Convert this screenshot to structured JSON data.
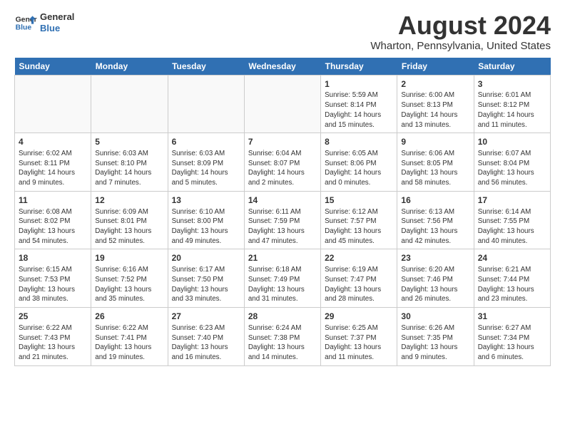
{
  "header": {
    "logo_line1": "General",
    "logo_line2": "Blue",
    "month_year": "August 2024",
    "location": "Wharton, Pennsylvania, United States"
  },
  "weekdays": [
    "Sunday",
    "Monday",
    "Tuesday",
    "Wednesday",
    "Thursday",
    "Friday",
    "Saturday"
  ],
  "weeks": [
    [
      {
        "day": "",
        "empty": true
      },
      {
        "day": "",
        "empty": true
      },
      {
        "day": "",
        "empty": true
      },
      {
        "day": "",
        "empty": true
      },
      {
        "day": "1",
        "sunrise": "5:59 AM",
        "sunset": "8:14 PM",
        "daylight": "14 hours and 15 minutes."
      },
      {
        "day": "2",
        "sunrise": "6:00 AM",
        "sunset": "8:13 PM",
        "daylight": "14 hours and 13 minutes."
      },
      {
        "day": "3",
        "sunrise": "6:01 AM",
        "sunset": "8:12 PM",
        "daylight": "14 hours and 11 minutes."
      }
    ],
    [
      {
        "day": "4",
        "sunrise": "6:02 AM",
        "sunset": "8:11 PM",
        "daylight": "14 hours and 9 minutes."
      },
      {
        "day": "5",
        "sunrise": "6:03 AM",
        "sunset": "8:10 PM",
        "daylight": "14 hours and 7 minutes."
      },
      {
        "day": "6",
        "sunrise": "6:03 AM",
        "sunset": "8:09 PM",
        "daylight": "14 hours and 5 minutes."
      },
      {
        "day": "7",
        "sunrise": "6:04 AM",
        "sunset": "8:07 PM",
        "daylight": "14 hours and 2 minutes."
      },
      {
        "day": "8",
        "sunrise": "6:05 AM",
        "sunset": "8:06 PM",
        "daylight": "14 hours and 0 minutes."
      },
      {
        "day": "9",
        "sunrise": "6:06 AM",
        "sunset": "8:05 PM",
        "daylight": "13 hours and 58 minutes."
      },
      {
        "day": "10",
        "sunrise": "6:07 AM",
        "sunset": "8:04 PM",
        "daylight": "13 hours and 56 minutes."
      }
    ],
    [
      {
        "day": "11",
        "sunrise": "6:08 AM",
        "sunset": "8:02 PM",
        "daylight": "13 hours and 54 minutes."
      },
      {
        "day": "12",
        "sunrise": "6:09 AM",
        "sunset": "8:01 PM",
        "daylight": "13 hours and 52 minutes."
      },
      {
        "day": "13",
        "sunrise": "6:10 AM",
        "sunset": "8:00 PM",
        "daylight": "13 hours and 49 minutes."
      },
      {
        "day": "14",
        "sunrise": "6:11 AM",
        "sunset": "7:59 PM",
        "daylight": "13 hours and 47 minutes."
      },
      {
        "day": "15",
        "sunrise": "6:12 AM",
        "sunset": "7:57 PM",
        "daylight": "13 hours and 45 minutes."
      },
      {
        "day": "16",
        "sunrise": "6:13 AM",
        "sunset": "7:56 PM",
        "daylight": "13 hours and 42 minutes."
      },
      {
        "day": "17",
        "sunrise": "6:14 AM",
        "sunset": "7:55 PM",
        "daylight": "13 hours and 40 minutes."
      }
    ],
    [
      {
        "day": "18",
        "sunrise": "6:15 AM",
        "sunset": "7:53 PM",
        "daylight": "13 hours and 38 minutes."
      },
      {
        "day": "19",
        "sunrise": "6:16 AM",
        "sunset": "7:52 PM",
        "daylight": "13 hours and 35 minutes."
      },
      {
        "day": "20",
        "sunrise": "6:17 AM",
        "sunset": "7:50 PM",
        "daylight": "13 hours and 33 minutes."
      },
      {
        "day": "21",
        "sunrise": "6:18 AM",
        "sunset": "7:49 PM",
        "daylight": "13 hours and 31 minutes."
      },
      {
        "day": "22",
        "sunrise": "6:19 AM",
        "sunset": "7:47 PM",
        "daylight": "13 hours and 28 minutes."
      },
      {
        "day": "23",
        "sunrise": "6:20 AM",
        "sunset": "7:46 PM",
        "daylight": "13 hours and 26 minutes."
      },
      {
        "day": "24",
        "sunrise": "6:21 AM",
        "sunset": "7:44 PM",
        "daylight": "13 hours and 23 minutes."
      }
    ],
    [
      {
        "day": "25",
        "sunrise": "6:22 AM",
        "sunset": "7:43 PM",
        "daylight": "13 hours and 21 minutes."
      },
      {
        "day": "26",
        "sunrise": "6:22 AM",
        "sunset": "7:41 PM",
        "daylight": "13 hours and 19 minutes."
      },
      {
        "day": "27",
        "sunrise": "6:23 AM",
        "sunset": "7:40 PM",
        "daylight": "13 hours and 16 minutes."
      },
      {
        "day": "28",
        "sunrise": "6:24 AM",
        "sunset": "7:38 PM",
        "daylight": "13 hours and 14 minutes."
      },
      {
        "day": "29",
        "sunrise": "6:25 AM",
        "sunset": "7:37 PM",
        "daylight": "13 hours and 11 minutes."
      },
      {
        "day": "30",
        "sunrise": "6:26 AM",
        "sunset": "7:35 PM",
        "daylight": "13 hours and 9 minutes."
      },
      {
        "day": "31",
        "sunrise": "6:27 AM",
        "sunset": "7:34 PM",
        "daylight": "13 hours and 6 minutes."
      }
    ]
  ]
}
